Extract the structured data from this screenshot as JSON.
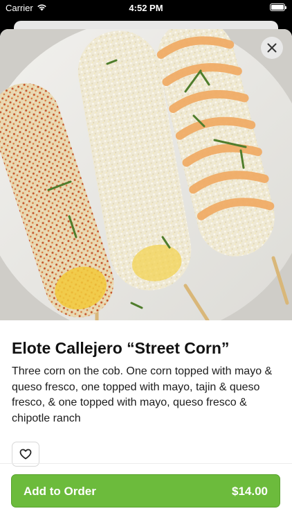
{
  "status_bar": {
    "carrier": "Carrier",
    "time": "4:52 PM"
  },
  "item": {
    "title": "Elote Callejero “Street Corn”",
    "description": "Three corn on the cob. One corn topped with mayo & queso fresco, one topped with mayo, tajin & queso fresco, & one topped with mayo, queso fresco & chipotle ranch",
    "image_alt": "Three elote street corn cobs on skewers with toppings"
  },
  "actions": {
    "add_label": "Add to Order",
    "price": "$14.00"
  },
  "icons": {
    "close": "close-icon",
    "favorite": "heart-icon",
    "wifi": "wifi-icon",
    "battery": "battery-icon"
  },
  "colors": {
    "accent": "#6cbb3c",
    "text": "#111111"
  }
}
